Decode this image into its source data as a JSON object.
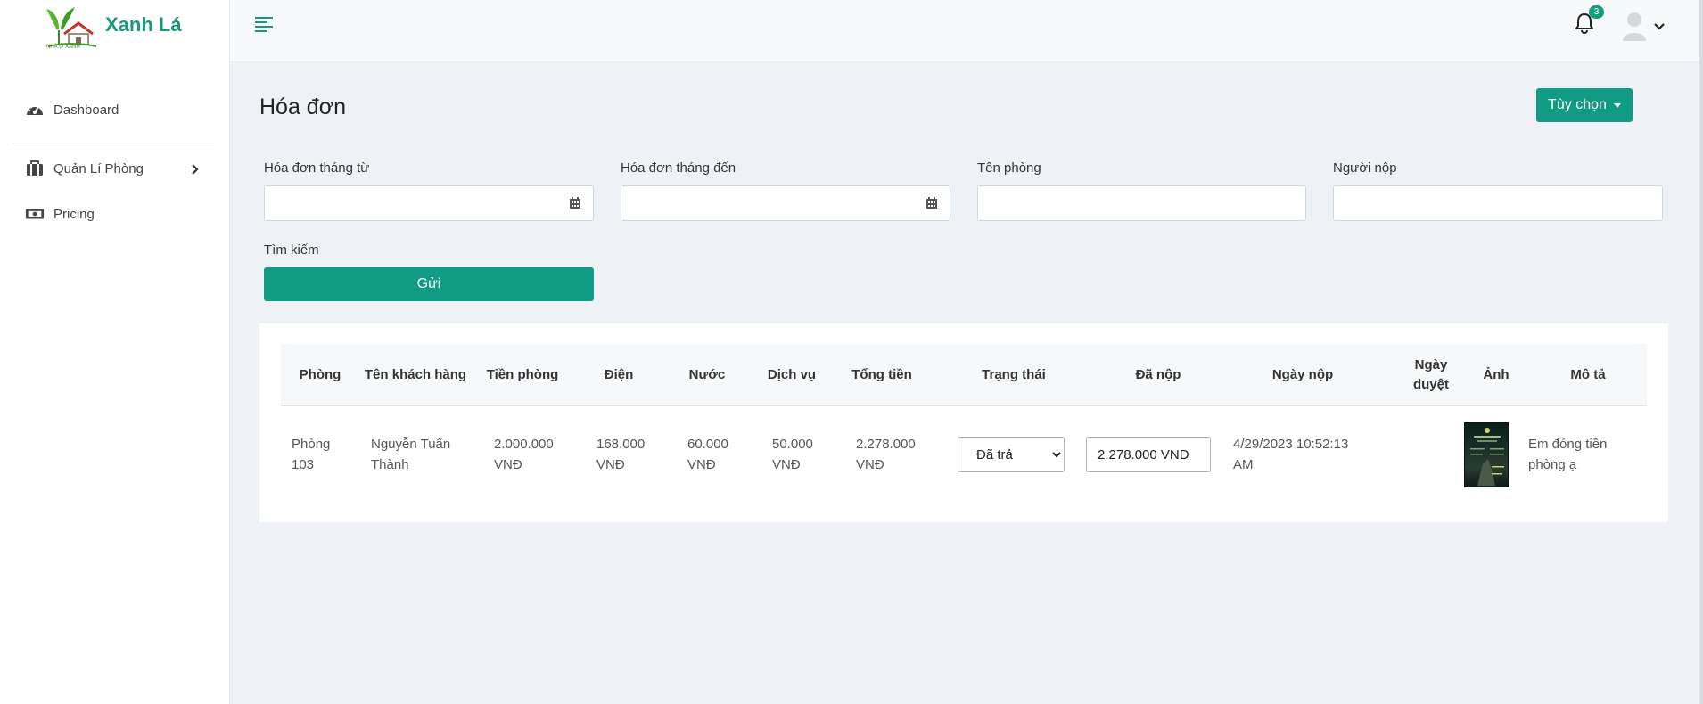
{
  "brand": {
    "name": "Xanh Lá",
    "logo_caption": "NHÀ Ở XANH"
  },
  "sidebar": {
    "items": [
      {
        "label": "Dashboard",
        "icon": "tachometer-icon"
      },
      {
        "label": "Quản Lí Phòng",
        "icon": "suitcase-icon",
        "has_submenu": true
      },
      {
        "label": "Pricing",
        "icon": "money-bill-icon"
      }
    ]
  },
  "topbar": {
    "notification_count": "3"
  },
  "page": {
    "title": "Hóa đơn",
    "options_label": "Tùy chọn"
  },
  "filters": {
    "from_label": "Hóa đơn tháng từ",
    "to_label": "Hóa đơn tháng đến",
    "room_label": "Tên phòng",
    "payer_label": "Người nộp",
    "search_label": "Tìm kiếm",
    "submit_label": "Gửi"
  },
  "table": {
    "headers": [
      "Phòng",
      "Tên khách hàng",
      "Tiền phòng",
      "Điện",
      "Nước",
      "Dịch vụ",
      "Tổng tiền",
      "Trạng thái",
      "Đã nộp",
      "Ngày nộp",
      "Ngày duyệt",
      "Ảnh",
      "Mô tả"
    ],
    "rows": [
      {
        "room": "Phòng 103",
        "customer": "Nguyễn Tuấn Thành",
        "rent": "2.000.000 VNĐ",
        "electric": "168.000 VNĐ",
        "water": "60.000 VNĐ",
        "service": "50.000 VNĐ",
        "total": "2.278.000 VNĐ",
        "status": "Đã trả",
        "paid": "2.278.000 VND",
        "paid_date": "4/29/2023 10:52:13 AM",
        "approved_date": "",
        "description": "Em đóng tiền phòng ạ"
      }
    ]
  },
  "colors": {
    "accent": "#0f9b84",
    "brand": "#1a9a7c",
    "background": "#eef2f6"
  }
}
